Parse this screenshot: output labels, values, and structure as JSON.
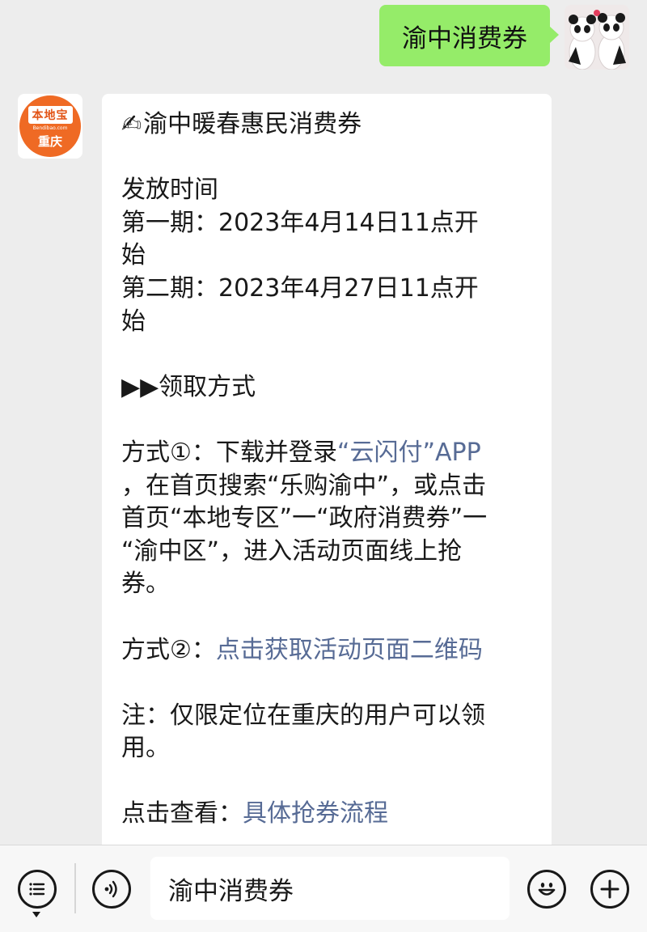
{
  "outgoing": {
    "text": "渝中消费券"
  },
  "incoming": {
    "avatar": {
      "top_text": "本地宝",
      "url_text": "Bendibao.com",
      "city_text": "重庆"
    },
    "emoji": "✍",
    "title": "渝中暖春惠民消费券",
    "release_heading": "发放时间",
    "period1_a": "第一期：2023年4月14日11点开",
    "period1_b": "始",
    "period2_a": "第二期：2023年4月27日11点开",
    "period2_b": "始",
    "method_heading": "▶▶领取方式",
    "method1_prefix": "方式①：下载并登录",
    "method1_link": "“云闪付”APP",
    "method1_l2": "，在首页搜索“乐购渝中”，或点击",
    "method1_l3": "首页“本地专区”一“政府消费券”一",
    "method1_l4": "“渝中区”，进入活动页面线上抢",
    "method1_l5": "券。",
    "method2_prefix": "方式②：",
    "method2_link": "点击获取活动页面二维码",
    "note_l1": "注：仅限定位在重庆的用户可以领",
    "note_l2": "用。",
    "view_prefix": "点击查看：",
    "view_link": "具体抢券流程"
  },
  "input_bar": {
    "value": "渝中消费券",
    "icons": [
      "menu-icon",
      "voice-icon",
      "emoji-icon",
      "plus-icon"
    ]
  },
  "colors": {
    "outgoing_bubble": "#95ec69",
    "link": "#576b95",
    "background": "#ededed",
    "brand_orange": "#ef6a24"
  }
}
